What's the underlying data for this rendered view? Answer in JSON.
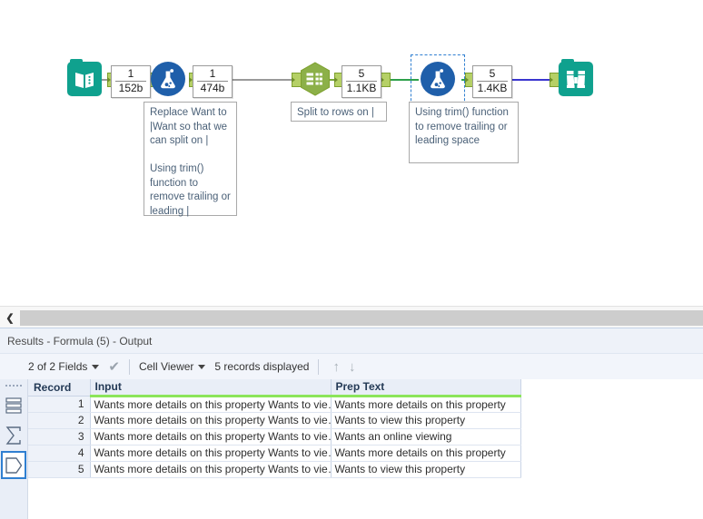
{
  "canvas": {
    "tools": [
      {
        "id": "input-data",
        "icon": "book-icon",
        "label": "Input Data"
      },
      {
        "id": "formula-1",
        "icon": "flask-icon",
        "label": "Formula"
      },
      {
        "id": "text-to-columns",
        "icon": "table-hexagon-icon",
        "label": "Text To Columns"
      },
      {
        "id": "formula-2",
        "icon": "flask-icon",
        "label": "Formula",
        "selected": true
      },
      {
        "id": "browse",
        "icon": "binoculars-icon",
        "label": "Browse"
      }
    ],
    "counts": [
      {
        "records": "1",
        "size": "152b"
      },
      {
        "records": "1",
        "size": "474b"
      },
      {
        "records": "5",
        "size": "1.1KB"
      },
      {
        "records": "5",
        "size": "1.4KB"
      }
    ],
    "annotations": [
      {
        "id": "annotation-formula-1",
        "text": "Replace Want to |Want so that we can split on |\n\nUsing trim() function to remove trailing or leading |"
      },
      {
        "id": "annotation-text-to-columns",
        "text": "Split to rows on |"
      },
      {
        "id": "annotation-formula-2",
        "text": "Using trim() function to remove trailing or leading space"
      }
    ],
    "connection_colors": {
      "gray": "#9a9a9a",
      "green": "#2ea04b",
      "purple": "#3a35cf",
      "plug": "#b5d066"
    }
  },
  "splitter": {
    "collapse_glyph": "❮"
  },
  "results": {
    "title": "Results - Formula (5) - Output",
    "toolbar": {
      "fields_label": "2 of 2 Fields",
      "viewer_label": "Cell Viewer",
      "records_label": "5 records displayed",
      "up_arrow": "↑",
      "down_arrow": "↓",
      "check_glyph": "✔"
    },
    "rail": [
      {
        "id": "rail-data-icon",
        "name": "data-rows-icon",
        "selected": false
      },
      {
        "id": "rail-profile-icon",
        "name": "sigma-icon",
        "selected": false
      },
      {
        "id": "rail-metadata-icon",
        "name": "pentagon-icon",
        "selected": true
      }
    ],
    "table": {
      "columns": [
        "Record",
        "Input",
        "Prep Text"
      ],
      "rows": [
        {
          "record": "1",
          "input": "Wants more details on this property Wants to vie…",
          "prep": "Wants more details on this property"
        },
        {
          "record": "2",
          "input": "Wants more details on this property Wants to vie…",
          "prep": "Wants to view this property"
        },
        {
          "record": "3",
          "input": "Wants more details on this property Wants to vie…",
          "prep": "Wants an online viewing"
        },
        {
          "record": "4",
          "input": "Wants more details on this property Wants to vie…",
          "prep": "Wants more details on this property"
        },
        {
          "record": "5",
          "input": "Wants more details on this property Wants to vie…",
          "prep": "Wants to view this property"
        }
      ]
    }
  }
}
